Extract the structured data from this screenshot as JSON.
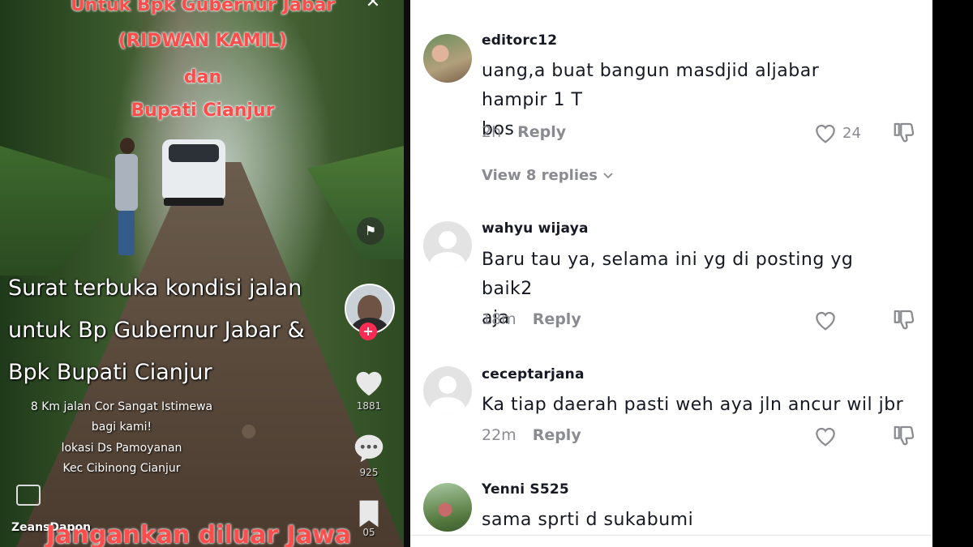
{
  "video": {
    "top_text_1": "Untuk Bpk Gubernur Jabar",
    "top_text_2": "(RIDWAN KAMIL)",
    "top_text_3": "dan",
    "top_text_4": "Bupati Cianjur",
    "caption_big_1": "Surat terbuka kondisi jalan",
    "caption_big_2": "untuk Bp Gubernur Jabar &",
    "caption_big_3": "Bpk Bupati Cianjur",
    "caption_small_1": "8 Km jalan Cor Sangat Istimewa",
    "caption_small_2": "bagi kami!",
    "caption_small_3": "lokasi Ds Pamoyanan",
    "caption_small_4": "Kec Cibinong Cianjur",
    "bottom_red_text": "Jangankan diluar Jawa",
    "brand": "ZeansDapon",
    "like_count": "1881",
    "comment_count": "925",
    "save_count": "05",
    "plus_label": "+",
    "close_label": "✕",
    "flag_label": "⚑"
  },
  "comments": [
    {
      "user": "editorc12",
      "text_line1": "uang,a buat bangun masdjid aljabar hampir 1 T",
      "text_line2": "bos",
      "time": "2h",
      "reply": "Reply",
      "likes": "24",
      "avatar": "photo"
    },
    {
      "user": "wahyu wijaya",
      "text_line1": "Baru tau ya, selama ini yg di posting yg baik2",
      "text_line2": "aja",
      "time": "18m",
      "reply": "Reply",
      "likes": "",
      "avatar": "blank"
    },
    {
      "user": "ceceptarjana",
      "text_line1": "Ka tiap daerah pasti weh aya jln ancur wil jbr",
      "text_line2": "",
      "time": "22m",
      "reply": "Reply",
      "likes": "",
      "avatar": "blank"
    },
    {
      "user": "Yenni S525",
      "text_line1": "sama sprti d sukabumi",
      "text_line2": "",
      "time": "",
      "reply": "",
      "likes": "",
      "avatar": "photo"
    }
  ],
  "view_replies": "View 8 replies",
  "icons": {
    "heart": "heart-icon",
    "dislike": "dislike-icon",
    "comment": "comment-icon",
    "bookmark": "bookmark-icon",
    "flag": "flag-icon",
    "chevron": "chevron-down-icon"
  },
  "colors": {
    "accent": "#fe2c55",
    "meta_gray": "#8a8b91",
    "text": "#161823",
    "overlay_red": "#ff4d4d"
  }
}
